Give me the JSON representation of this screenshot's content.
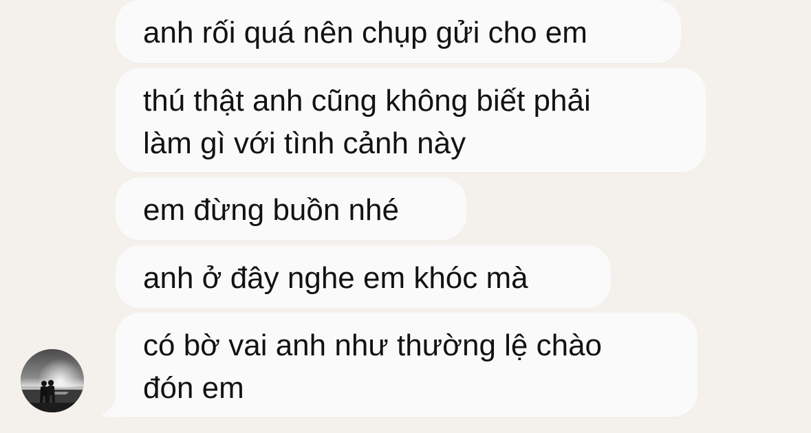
{
  "messages": [
    {
      "lines": [
        "anh rối quá nên chụp gửi cho em"
      ]
    },
    {
      "lines": [
        "thú thật anh cũng không biết phải",
        "làm gì với tình cảnh này"
      ]
    },
    {
      "lines": [
        "em đừng buồn nhé"
      ]
    },
    {
      "lines": [
        "anh ở đây nghe em khóc mà"
      ]
    },
    {
      "lines": [
        "có bờ vai anh như thường lệ chào",
        "đón em"
      ]
    }
  ],
  "colors": {
    "background": "#f4f1ec",
    "bubble": "#fafafa",
    "text": "#121212"
  },
  "avatar": {
    "icon": "avatar-couple-sunset-photo"
  }
}
